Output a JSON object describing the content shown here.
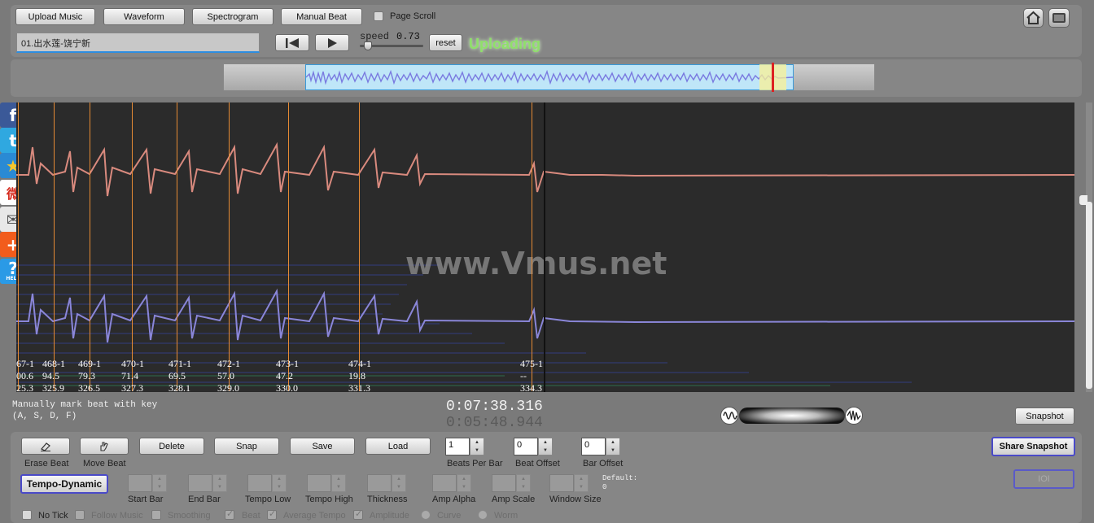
{
  "toolbar": {
    "upload_label": "Upload Music",
    "waveform_label": "Waveform",
    "spectrogram_label": "Spectrogram",
    "manual_beat_label": "Manual Beat",
    "page_scroll_label": "Page Scroll",
    "track_name": "01.出水莲-饶宁新",
    "speed_label": "speed",
    "speed_value": "0.73",
    "reset_label": "reset",
    "status_text": "Uploading"
  },
  "social": {
    "items": [
      {
        "name": "facebook-icon",
        "glyph": "f",
        "color": "#3b5998"
      },
      {
        "name": "twitter-icon",
        "glyph": "t",
        "color": "#2fa8e0"
      },
      {
        "name": "star-icon",
        "glyph": "★",
        "color": "#2a8ad4"
      },
      {
        "name": "weibo-icon",
        "glyph": "微",
        "color": "#d52b1e"
      },
      {
        "name": "mail-icon",
        "glyph": "✉",
        "color": "#e8e8e8"
      },
      {
        "name": "share-plus-icon",
        "glyph": "+",
        "color": "#f25c1c"
      },
      {
        "name": "help-icon",
        "glyph": "?",
        "color": "#2a9ae6"
      }
    ],
    "help_caption": "HELP"
  },
  "main_view": {
    "watermark": "www.Vmus.net",
    "beats": [
      {
        "id": "67-1",
        "a": "00.6",
        "b": "25.3"
      },
      {
        "id": "468-1",
        "a": "94.5",
        "b": "325.9"
      },
      {
        "id": "469-1",
        "a": "79.3",
        "b": "326.5"
      },
      {
        "id": "470-1",
        "a": "71.4",
        "b": "327.3"
      },
      {
        "id": "471-1",
        "a": "69.5",
        "b": "328.1"
      },
      {
        "id": "472-1",
        "a": "57.0",
        "b": "329.0"
      },
      {
        "id": "473-1",
        "a": "47.2",
        "b": "330.0"
      },
      {
        "id": "474-1",
        "a": "19.8",
        "b": "331.3"
      },
      {
        "id": "475-1",
        "a": "--",
        "b": "334.3"
      }
    ]
  },
  "status": {
    "hint_line1": "Manually mark beat with key",
    "hint_line2": "(A, S, D, F)",
    "time_total": "0:07:38.316",
    "time_current": "0:05:48.944",
    "snapshot_label": "Snapshot"
  },
  "controls": {
    "erase_beat": "Erase Beat",
    "move_beat": "Move Beat",
    "delete": "Delete",
    "snap": "Snap",
    "save": "Save",
    "load": "Load",
    "beats_per_bar_label": "Beats Per Bar",
    "beats_per_bar_value": "1",
    "beat_offset_label": "Beat Offset",
    "beat_offset_value": "0",
    "bar_offset_label": "Bar Offset",
    "bar_offset_value": "0",
    "share_snapshot": "Share Snapshot",
    "ioi_label": "IOI",
    "tempo_dynamic": "Tempo-Dynamic",
    "start_bar": "Start Bar",
    "end_bar": "End Bar",
    "tempo_low": "Tempo Low",
    "tempo_high": "Tempo High",
    "thickness": "Thickness",
    "amp_alpha": "Amp Alpha",
    "amp_scale": "Amp Scale",
    "window_size": "Window Size",
    "default_label": "Default:",
    "default_value": "0",
    "no_tick": "No Tick",
    "follow_music": "Follow Music",
    "smoothing": "Smoothing",
    "beat": "Beat",
    "average_tempo": "Average Tempo",
    "amplitude": "Amplitude",
    "curve": "Curve",
    "worm": "Worm"
  },
  "colors": {
    "accent_green": "#8fe06a",
    "beat_line": "#e58a34",
    "wave_top": "#d98a7e",
    "wave_bottom": "#8a86d8"
  }
}
